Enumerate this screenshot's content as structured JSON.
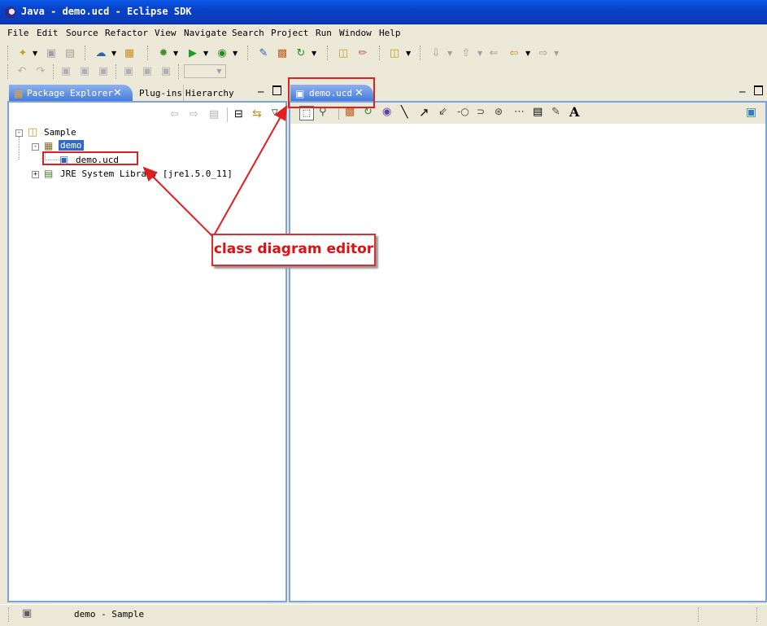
{
  "window": {
    "title": "Java - demo.ucd - Eclipse SDK"
  },
  "menu": [
    "File",
    "Edit",
    "Source",
    "Refactor",
    "View",
    "Navigate",
    "Search",
    "Project",
    "Run",
    "Window",
    "Help"
  ],
  "left_panel": {
    "tabs": [
      {
        "label": "Package Explorer",
        "active": true
      },
      {
        "label": "Plug-ins",
        "active": false
      },
      {
        "label": "Hierarchy",
        "active": false
      }
    ],
    "tree": [
      {
        "label": "Sample",
        "icon": "project-icon",
        "expanded": true
      },
      {
        "label": "demo",
        "icon": "package-icon",
        "expanded": true,
        "selected": true
      },
      {
        "label": "demo.ucd",
        "icon": "class-diagram-file-icon"
      },
      {
        "label": "JRE System Library [jre1.5.0_11]",
        "icon": "library-icon",
        "expanded": false
      }
    ]
  },
  "editor": {
    "tab_label": "demo.ucd",
    "palette_tools": [
      "select-tool",
      "zoom-tool",
      "class-tool",
      "interface-tool",
      "enum-tool",
      "association-tool",
      "generalization-tool",
      "dependency-tool",
      "lollipop-tool",
      "socket-tool",
      "port-tool",
      "note-link-tool",
      "note-tool",
      "constraint-tool",
      "text-tool"
    ]
  },
  "annotation": {
    "text": "class diagram editor",
    "color": "#e01010"
  },
  "status": {
    "text": "demo - Sample"
  },
  "colors": {
    "title_bar": "#0842c6",
    "tab_active": "#3f77d8",
    "panel_border": "#7ba3dd",
    "chrome": "#ece9d8"
  }
}
